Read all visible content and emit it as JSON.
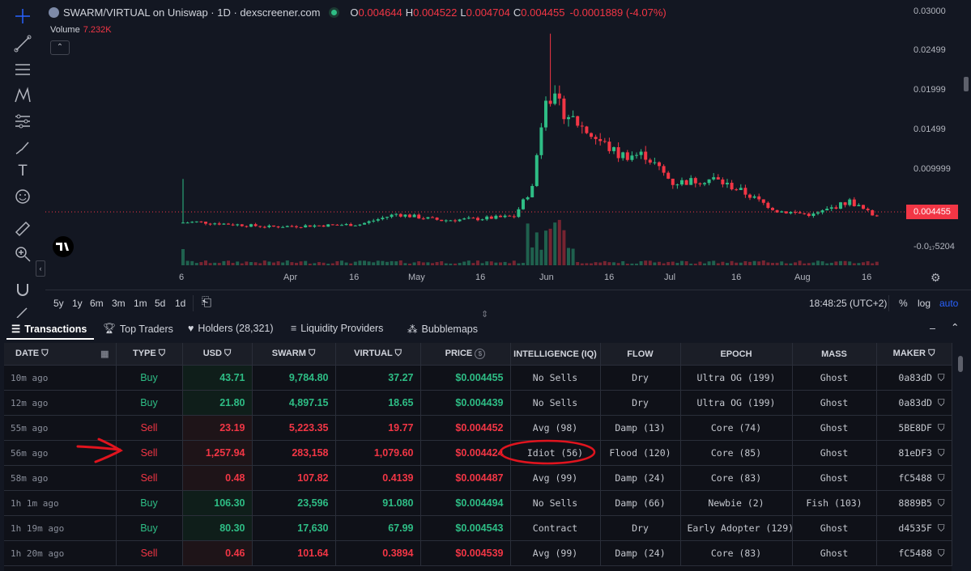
{
  "header": {
    "pair": "SWARM/VIRTUAL on Uniswap · 1D · dexscreener.com",
    "o_label": "O",
    "o_val": "0.004644",
    "h_label": "H",
    "h_val": "0.004522",
    "l_label": "L",
    "l_val": "0.004704",
    "c_label": "C",
    "c_val": "0.004455",
    "change": "-0.0001889 (-4.07%)",
    "volume_label": "Volume",
    "volume_val": "7.232K"
  },
  "price_axis": [
    "0.03000",
    "0.02499",
    "0.01999",
    "0.01499",
    "0.009999",
    "0.004455",
    "-0.0₁₇5204"
  ],
  "current_price": "0.004455",
  "time_axis": [
    "6",
    "Apr",
    "16",
    "May",
    "16",
    "Jun",
    "16",
    "Jul",
    "16",
    "Aug",
    "16"
  ],
  "ranges": [
    "5y",
    "1y",
    "6m",
    "3m",
    "1m",
    "5d",
    "1d"
  ],
  "clock": "18:48:25 (UTC+2)",
  "scale_opts": [
    "%",
    "log",
    "auto"
  ],
  "tabs": [
    "Transactions",
    "Top Traders",
    "Holders (28,321)",
    "Liquidity Providers",
    "Bubblemaps"
  ],
  "columns": [
    "DATE",
    "TYPE",
    "USD",
    "SWARM",
    "VIRTUAL",
    "PRICE",
    "INTELLIGENCE (IQ)",
    "FLOW",
    "EPOCH",
    "MASS",
    "MAKER"
  ],
  "rows": [
    {
      "date": "10m ago",
      "type": "Buy",
      "usd": "43.71",
      "swarm": "9,784.80",
      "virtual": "37.27",
      "price": "$0.004455",
      "iq": "No Sells",
      "flow": "Dry",
      "epoch": "Ultra OG (199)",
      "mass": "Ghost",
      "maker": "0a83dD"
    },
    {
      "date": "12m ago",
      "type": "Buy",
      "usd": "21.80",
      "swarm": "4,897.15",
      "virtual": "18.65",
      "price": "$0.004439",
      "iq": "No Sells",
      "flow": "Dry",
      "epoch": "Ultra OG (199)",
      "mass": "Ghost",
      "maker": "0a83dD"
    },
    {
      "date": "55m ago",
      "type": "Sell",
      "usd": "23.19",
      "swarm": "5,223.35",
      "virtual": "19.77",
      "price": "$0.004452",
      "iq": "Avg (98)",
      "flow": "Damp (13)",
      "epoch": "Core (74)",
      "mass": "Ghost",
      "maker": "5BE8DF"
    },
    {
      "date": "56m ago",
      "type": "Sell",
      "usd": "1,257.94",
      "swarm": "283,158",
      "virtual": "1,079.60",
      "price": "$0.004424",
      "iq": "Idiot (56)",
      "flow": "Flood (120)",
      "epoch": "Core (85)",
      "mass": "Ghost",
      "maker": "81eDF3"
    },
    {
      "date": "58m ago",
      "type": "Sell",
      "usd": "0.48",
      "swarm": "107.82",
      "virtual": "0.4139",
      "price": "$0.004487",
      "iq": "Avg (99)",
      "flow": "Damp (24)",
      "epoch": "Core (83)",
      "mass": "Ghost",
      "maker": "fC5488"
    },
    {
      "date": "1h 1m ago",
      "type": "Buy",
      "usd": "106.30",
      "swarm": "23,596",
      "virtual": "91.080",
      "price": "$0.004494",
      "iq": "No Sells",
      "flow": "Damp (66)",
      "epoch": "Newbie (2)",
      "mass": "Fish (103)",
      "maker": "8889B5"
    },
    {
      "date": "1h 19m ago",
      "type": "Buy",
      "usd": "80.30",
      "swarm": "17,630",
      "virtual": "67.99",
      "price": "$0.004543",
      "iq": "Contract",
      "flow": "Dry",
      "epoch": "Early Adopter (129)",
      "mass": "Ghost",
      "maker": "d4535F"
    },
    {
      "date": "1h 20m ago",
      "type": "Sell",
      "usd": "0.46",
      "swarm": "101.64",
      "virtual": "0.3894",
      "price": "$0.004539",
      "iq": "Avg (99)",
      "flow": "Damp (24)",
      "epoch": "Core (83)",
      "mass": "Ghost",
      "maker": "fC5488"
    }
  ],
  "colors": {
    "up": "#2ebd85",
    "down": "#f23645",
    "bg": "#131722",
    "annotation": "#e0141e"
  }
}
